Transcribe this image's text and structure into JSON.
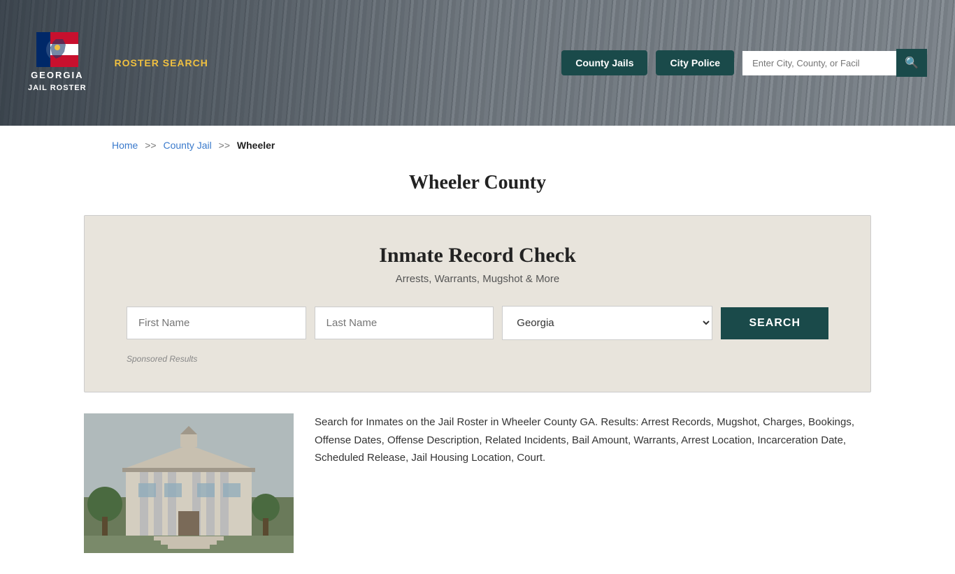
{
  "site": {
    "name_line1": "GEORGIA",
    "name_line2": "JAIL ROSTER"
  },
  "nav": {
    "roster_search": "ROSTER SEARCH",
    "county_jails": "County Jails",
    "city_police": "City Police",
    "search_placeholder": "Enter City, County, or Facil"
  },
  "breadcrumb": {
    "home": "Home",
    "sep1": ">>",
    "county_jail": "County Jail",
    "sep2": ">>",
    "current": "Wheeler"
  },
  "page_title": "Wheeler County",
  "record_check": {
    "title": "Inmate Record Check",
    "subtitle": "Arrests, Warrants, Mugshot & More",
    "first_name_placeholder": "First Name",
    "last_name_placeholder": "Last Name",
    "state_default": "Georgia",
    "search_button": "SEARCH",
    "sponsored_label": "Sponsored Results"
  },
  "description": "Search for Inmates on the Jail Roster in Wheeler County GA. Results: Arrest Records, Mugshot, Charges, Bookings, Offense Dates, Offense Description, Related Incidents, Bail Amount, Warrants, Arrest Location, Incarceration Date, Scheduled Release, Jail Housing Location, Court.",
  "colors": {
    "nav_btn_bg": "#1a4a4a",
    "search_btn_bg": "#1a4a4a",
    "accent": "#f0c040",
    "link": "#3a7acc"
  }
}
